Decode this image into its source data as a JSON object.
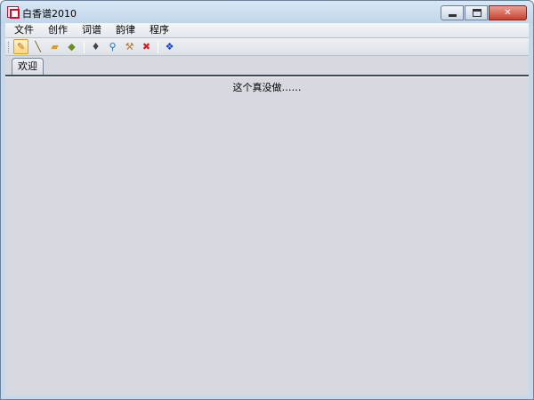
{
  "window": {
    "title": "白香谱2010",
    "app_icon": "app-logo-icon",
    "controls": {
      "minimize": "minimize-icon",
      "maximize": "maximize-icon",
      "close_label": "✕"
    }
  },
  "menubar": {
    "items": [
      {
        "label": "文件"
      },
      {
        "label": "创作"
      },
      {
        "label": "词谱"
      },
      {
        "label": "韵律"
      },
      {
        "label": "程序"
      }
    ]
  },
  "toolbar": {
    "buttons": [
      {
        "icon": "pencil-icon",
        "glyph": "✎",
        "color": "#c0651a"
      },
      {
        "icon": "brush-icon",
        "glyph": "╲",
        "color": "#7a4a1a"
      },
      {
        "icon": "folder-open-icon",
        "glyph": "▰",
        "color": "#d9a020"
      },
      {
        "icon": "save-icon",
        "glyph": "◆",
        "color": "#6b8e23"
      },
      {
        "icon": "pen-nib-icon",
        "glyph": "♦",
        "color": "#444444"
      },
      {
        "icon": "search-icon",
        "glyph": "⚲",
        "color": "#2a6fb0"
      },
      {
        "icon": "tools-icon",
        "glyph": "⚒",
        "color": "#b07a2a"
      },
      {
        "icon": "delete-icon",
        "glyph": "✖",
        "color": "#d42020"
      },
      {
        "icon": "paw-icon",
        "glyph": "❖",
        "color": "#1a3fd0"
      }
    ]
  },
  "tabs": [
    {
      "label": "欢迎",
      "selected": true
    }
  ],
  "content": {
    "message": "这个真没做……"
  }
}
